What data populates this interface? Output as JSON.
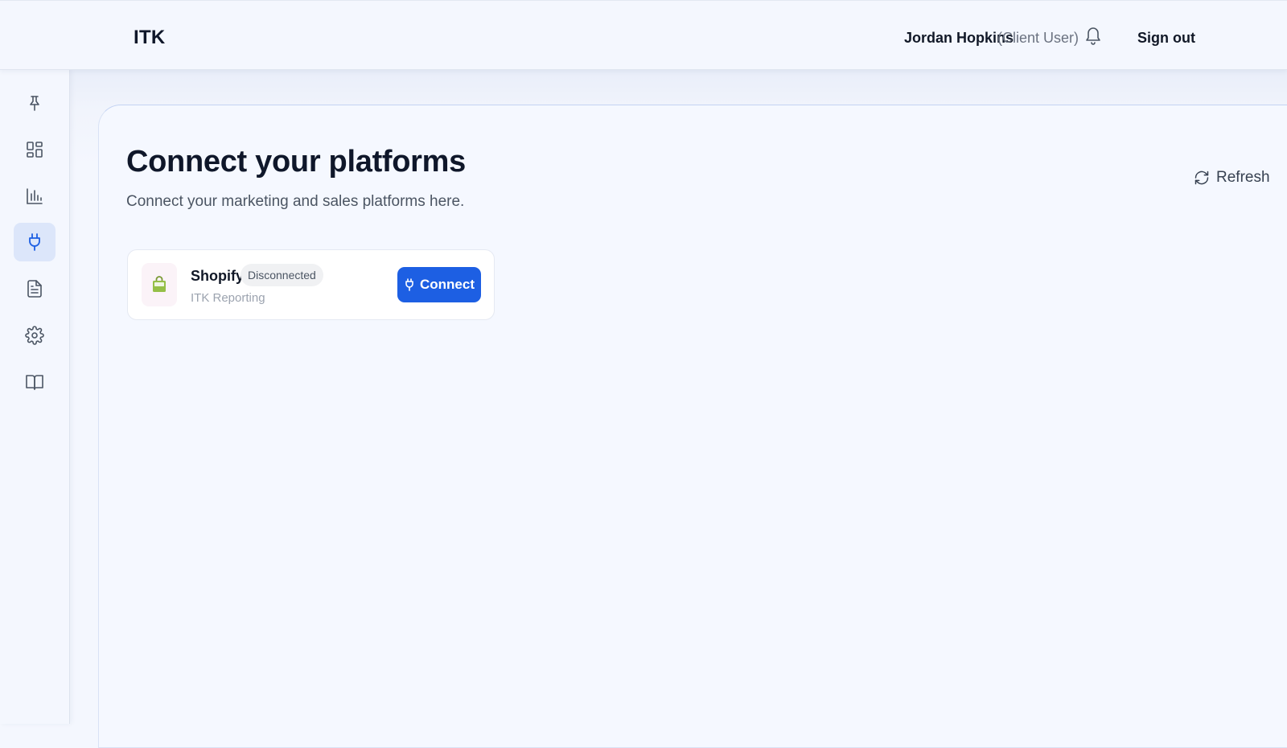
{
  "header": {
    "app_title": "ITK",
    "user_name": "Jordan Hopkins",
    "user_role": "(Client User)",
    "notifications_icon": "bell-icon",
    "sign_out_label": "Sign out"
  },
  "sidebar": {
    "items": [
      {
        "icon": "pin-icon",
        "active": false
      },
      {
        "icon": "dashboard-icon",
        "active": false
      },
      {
        "icon": "bar-chart-icon",
        "active": false
      },
      {
        "icon": "plug-icon",
        "active": true
      },
      {
        "icon": "document-icon",
        "active": false
      },
      {
        "icon": "gear-icon",
        "active": false
      },
      {
        "icon": "book-icon",
        "active": false
      }
    ]
  },
  "main": {
    "title": "Connect your platforms",
    "subtitle": "Connect your marketing and sales platforms here.",
    "refresh_label": "Refresh",
    "platforms": [
      {
        "name": "Shopify",
        "status": "Disconnected",
        "account": "ITK Reporting",
        "action_label": "Connect",
        "logo_icon": "shopify-bag-icon"
      }
    ]
  },
  "colors": {
    "accent": "#1d5fe3",
    "active_nav_bg": "#dce6fa",
    "page_bg": "#f4f7fe",
    "shopify_green": "#95bf47"
  }
}
